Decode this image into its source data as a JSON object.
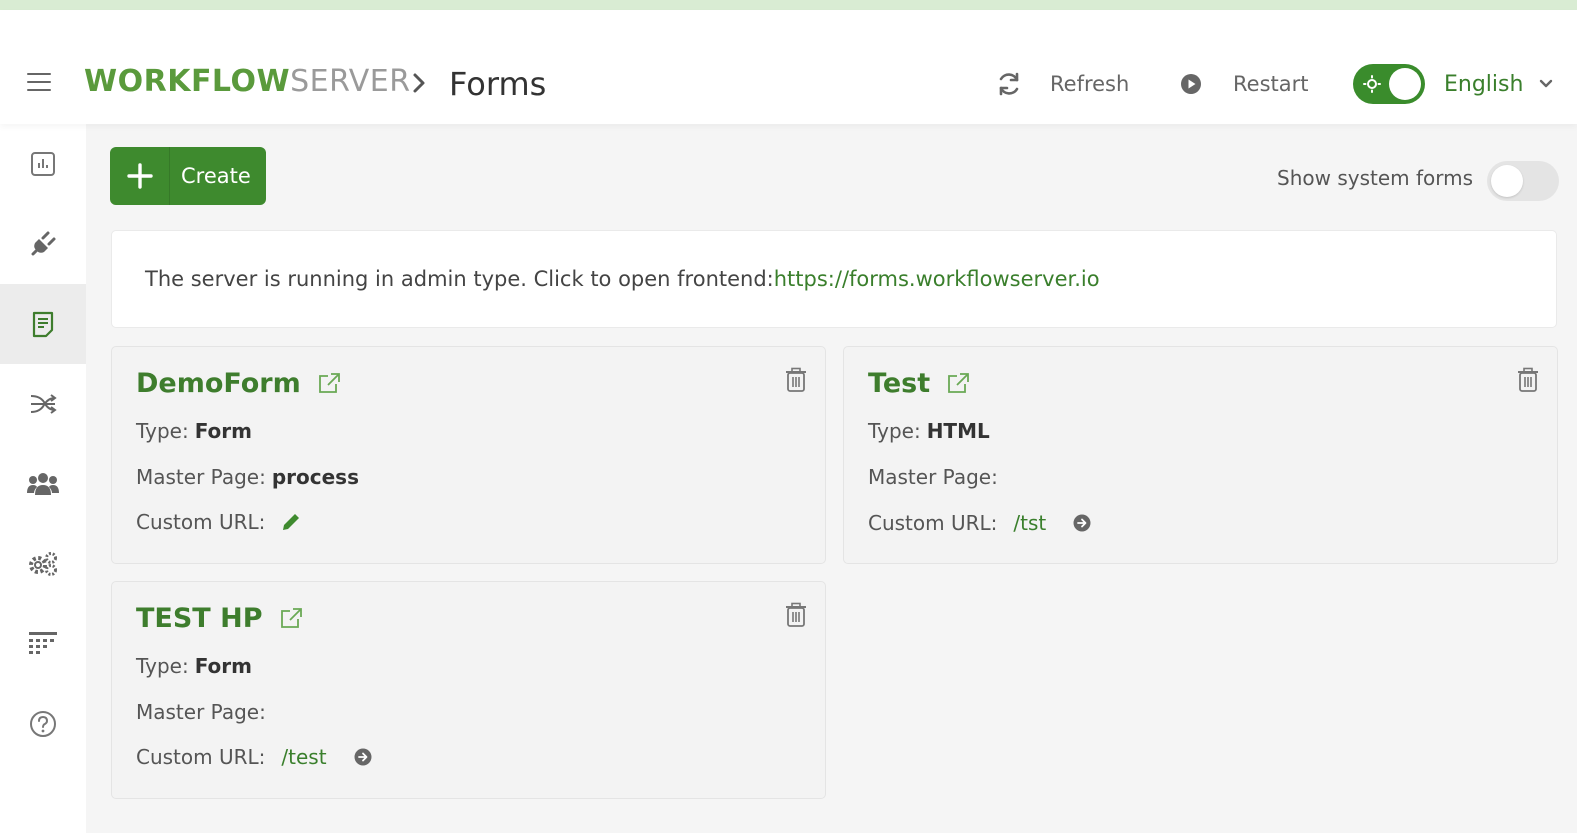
{
  "header": {
    "logo_part1": "WORKFLOW",
    "logo_part2": "SERVER",
    "page_title": "Forms",
    "refresh_label": "Refresh",
    "restart_label": "Restart",
    "language": "English"
  },
  "sidebar": {
    "items": [
      {
        "icon": "dashboard-icon"
      },
      {
        "icon": "plugin-icon"
      },
      {
        "icon": "forms-icon",
        "active": true
      },
      {
        "icon": "workflow-icon"
      },
      {
        "icon": "users-icon"
      },
      {
        "icon": "settings-icon"
      },
      {
        "icon": "grid-icon"
      },
      {
        "icon": "help-icon"
      }
    ]
  },
  "toolbar": {
    "create_label": "Create",
    "show_system_forms_label": "Show system forms"
  },
  "info": {
    "text": "The server is running in admin type. Click to open frontend:",
    "link": "https://forms.workflowserver.io"
  },
  "labels": {
    "type": "Type:",
    "master_page": "Master Page:",
    "custom_url": "Custom URL:"
  },
  "forms": [
    {
      "name": "DemoForm",
      "type": "Form",
      "master_page": "process",
      "custom_url": ""
    },
    {
      "name": "Test",
      "type": "HTML",
      "master_page": "",
      "custom_url": "/tst"
    },
    {
      "name": "TEST HP",
      "type": "Form",
      "master_page": "",
      "custom_url": "/test"
    }
  ],
  "colors": {
    "brand_green": "#3e8a2e",
    "link_green": "#3a7f2c",
    "logo_gray": "#9a9a9a"
  }
}
